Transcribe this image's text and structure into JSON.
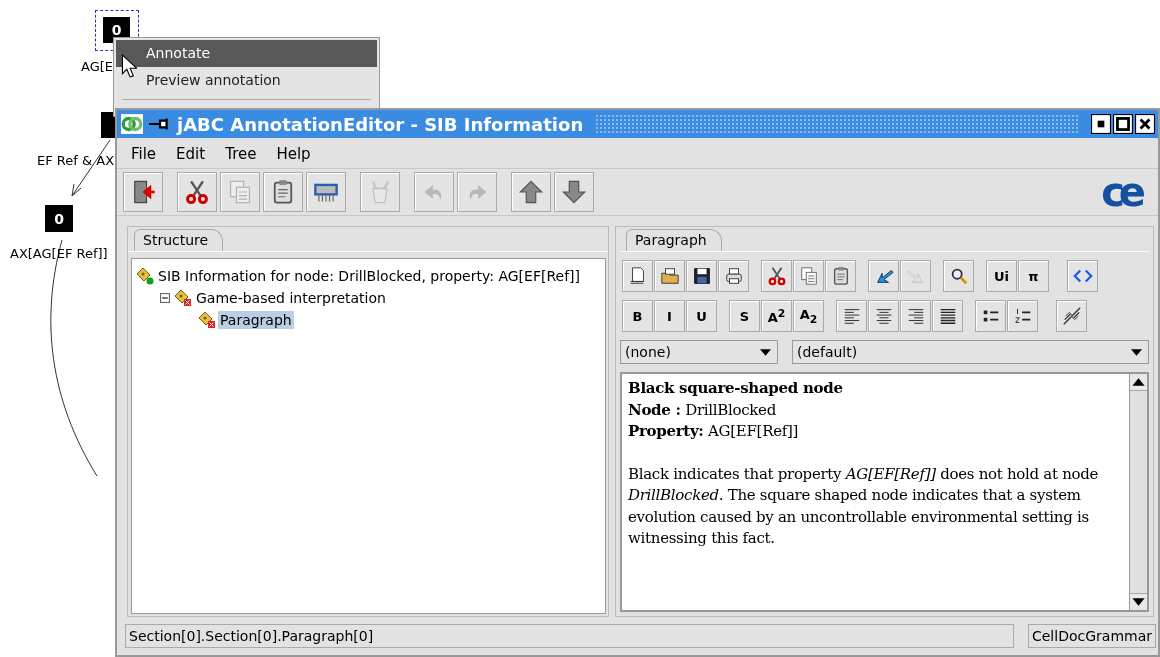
{
  "canvas": {
    "nodes": [
      {
        "label": "0"
      },
      {
        "label": "0"
      }
    ],
    "edge_labels": [
      "AG[E",
      "EF Ref & AX",
      "AX[AG[EF Ref]]"
    ]
  },
  "context_menu": {
    "items": [
      {
        "label": "Annotate",
        "selected": true
      },
      {
        "label": "Preview annotation",
        "selected": false
      }
    ]
  },
  "window": {
    "title": "jABC AnnotationEditor - SIB Information",
    "logo": "ce"
  },
  "menu_bar": [
    "File",
    "Edit",
    "Tree",
    "Help"
  ],
  "toolbar": [
    [
      {
        "kind": "exit",
        "disabled": false
      }
    ],
    [
      {
        "kind": "cut",
        "disabled": false
      },
      {
        "kind": "copy",
        "disabled": true
      },
      {
        "kind": "paste",
        "disabled": false
      },
      {
        "kind": "shred",
        "disabled": false
      }
    ],
    [
      {
        "kind": "clear",
        "disabled": true
      }
    ],
    [
      {
        "kind": "undo",
        "disabled": true
      },
      {
        "kind": "redo",
        "disabled": true
      }
    ],
    [
      {
        "kind": "up",
        "disabled": false
      },
      {
        "kind": "down",
        "disabled": false
      }
    ]
  ],
  "structure": {
    "tab": "Structure",
    "tree": [
      {
        "label": "SIB Information for node: DrillBlocked, property: AG[EF[Ref]]",
        "kind": "ok",
        "selected": false,
        "children": [
          {
            "label": "Game-based interpretation",
            "kind": "error",
            "selected": false,
            "expanded": true,
            "children": [
              {
                "label": "Paragraph",
                "kind": "error",
                "selected": true
              }
            ]
          }
        ]
      }
    ]
  },
  "paragraph": {
    "tab": "Paragraph",
    "toolbar_rows": [
      [
        [
          {
            "kind": "new",
            "disabled": false
          },
          {
            "kind": "open",
            "disabled": false
          },
          {
            "kind": "save",
            "disabled": false
          },
          {
            "kind": "print",
            "disabled": false
          }
        ],
        [
          {
            "kind": "cut",
            "disabled": false
          },
          {
            "kind": "copy",
            "disabled": false
          },
          {
            "kind": "paste",
            "disabled": false
          }
        ],
        [
          {
            "kind": "import",
            "disabled": false
          },
          {
            "kind": "export",
            "disabled": true
          }
        ],
        [
          {
            "kind": "find",
            "disabled": false
          }
        ],
        [
          {
            "kind": "text",
            "label": "Ui",
            "disabled": false
          },
          {
            "kind": "text",
            "label": "π",
            "disabled": false
          }
        ],
        [
          {
            "kind": "source",
            "disabled": false
          }
        ]
      ],
      [
        [
          {
            "kind": "text",
            "label": "B",
            "disabled": false
          },
          {
            "kind": "text",
            "label": "I",
            "disabled": false
          },
          {
            "kind": "text",
            "label": "U",
            "disabled": false
          }
        ],
        [
          {
            "kind": "text",
            "label": "S",
            "disabled": false
          },
          {
            "kind": "text",
            "label": "A$^{2}$",
            "disabled": false
          },
          {
            "kind": "text",
            "label": "A$_{2}$",
            "disabled": false
          }
        ],
        [
          {
            "kind": "align-left",
            "disabled": false
          },
          {
            "kind": "align-center",
            "disabled": false
          },
          {
            "kind": "align-right",
            "disabled": false
          },
          {
            "kind": "justify",
            "disabled": false
          }
        ],
        [
          {
            "kind": "bullets",
            "disabled": false
          },
          {
            "kind": "numbers",
            "disabled": false
          }
        ],
        [
          {
            "kind": "unlink",
            "disabled": false
          }
        ]
      ]
    ],
    "style_select": "(none)",
    "font_select": "(default)",
    "content": {
      "heading": "Black square-shaped node",
      "lines": [
        "**Node :** DrillBlocked",
        "**Property:** AG[EF[Ref]]"
      ],
      "body": "Black indicates that property *AG[EF[Ref]]* does not hold at node *DrillBlocked*. The square shaped node indicates that a system evolution caused by an uncontrollable environmental setting is witnessing this fact."
    }
  },
  "status_bar": [
    "Section[0].Section[0].Paragraph[0]",
    "CellDocGrammar"
  ]
}
